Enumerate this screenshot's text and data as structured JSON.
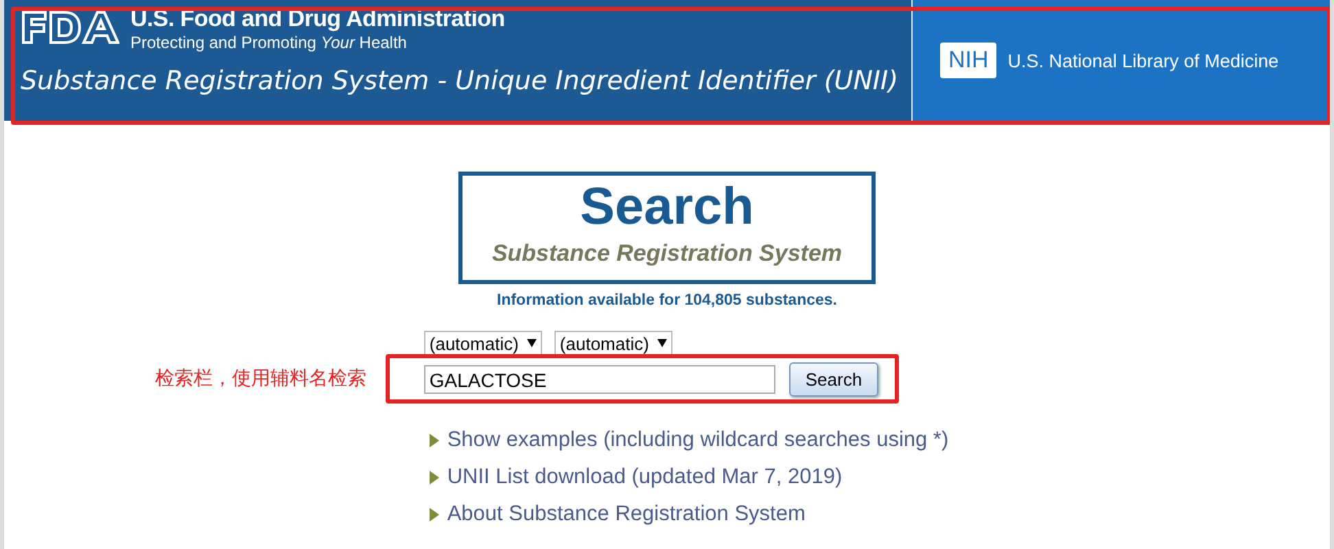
{
  "header": {
    "agency": "U.S. Food and Drug Administration",
    "tagline": "Protecting and Promoting *Your* Health",
    "system_title": "Substance Registration System - Unique Ingredient Identifier (UNII)",
    "nih_badge": "NIH",
    "nih_text": "U.S. National Library of Medicine"
  },
  "search_box": {
    "title": "Search",
    "subtitle": "Substance Registration System"
  },
  "info": "Information available for 104,805 substances.",
  "selects": [
    "(automatic)",
    "(automatic)"
  ],
  "annotation": "检索栏，使用辅料名检索",
  "search": {
    "value": "GALACTOSE",
    "button": "Search"
  },
  "links": [
    "Show examples (including wildcard searches using *)",
    "UNII List download (updated Mar 7, 2019)",
    "About Substance Registration System"
  ]
}
